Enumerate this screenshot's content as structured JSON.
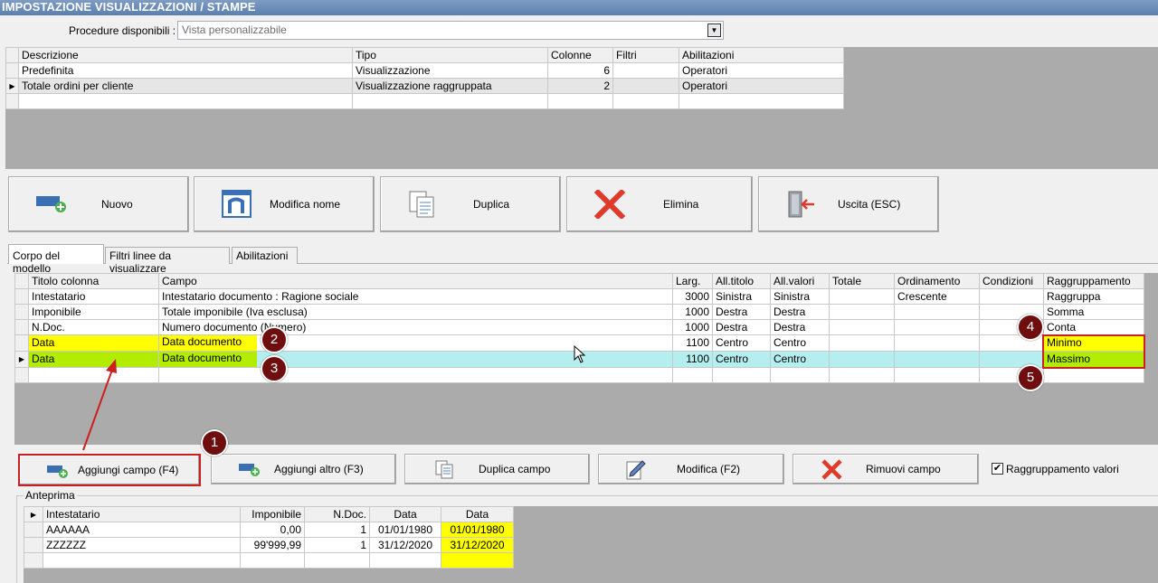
{
  "window": {
    "title": "IMPOSTAZIONE VISUALIZZAZIONI / STAMPE"
  },
  "procedure": {
    "label": "Procedure disponibili :",
    "value": "Vista personalizzabile"
  },
  "views_grid": {
    "headers": [
      "Descrizione",
      "Tipo",
      "Colonne",
      "Filtri",
      "Abilitazioni"
    ],
    "rows": [
      [
        "Predefinita",
        "Visualizzazione",
        "6",
        "",
        "Operatori"
      ],
      [
        "Totale ordini per cliente",
        "Visualizzazione raggruppata",
        "2",
        "",
        "Operatori"
      ]
    ]
  },
  "toolbar": {
    "nuovo": "Nuovo",
    "modifica_nome": "Modifica nome",
    "duplica": "Duplica",
    "elimina": "Elimina",
    "uscita": "Uscita (ESC)"
  },
  "tabs": [
    "Corpo del modello",
    "Filtri linee da visualizzare",
    "Abilitazioni"
  ],
  "fields_grid": {
    "headers": [
      "Titolo colonna",
      "Campo",
      "Larg.",
      "All.titolo",
      "All.valori",
      "Totale",
      "Ordinamento",
      "Condizioni",
      "Raggruppamento"
    ],
    "rows": [
      [
        "Intestatario",
        "Intestatario documento : Ragione sociale",
        "3000",
        "Sinistra",
        "Sinistra",
        "",
        "Crescente",
        "",
        "Raggruppa"
      ],
      [
        "Imponibile",
        "Totale imponibile (Iva esclusa)",
        "1000",
        "Destra",
        "Destra",
        "",
        "",
        "",
        "Somma"
      ],
      [
        "N.Doc.",
        "Numero documento (Numero)",
        "1000",
        "Destra",
        "Destra",
        "",
        "",
        "",
        "Conta"
      ],
      [
        "Data",
        "Data documento",
        "1100",
        "Centro",
        "Centro",
        "",
        "",
        "",
        "Minimo"
      ],
      [
        "Data",
        "Data documento",
        "1100",
        "Centro",
        "Centro",
        "",
        "",
        "",
        "Massimo"
      ]
    ]
  },
  "field_buttons": {
    "aggiungi_campo": "Aggiungi campo (F4)",
    "aggiungi_altro": "Aggiungi altro (F3)",
    "duplica_campo": "Duplica campo",
    "modifica": "Modifica (F2)",
    "rimuovi_campo": "Rimuovi campo"
  },
  "raggruppamento_valori": {
    "label": "Raggruppamento valori",
    "checked": true
  },
  "anteprima": {
    "label": "Anteprima",
    "headers": [
      "Intestatario",
      "Imponibile",
      "N.Doc.",
      "Data",
      "Data"
    ],
    "rows": [
      [
        "AAAAAA",
        "0,00",
        "1",
        "01/01/1980",
        "01/01/1980"
      ],
      [
        "ZZZZZZ",
        "99'999,99",
        "1",
        "31/12/2020",
        "31/12/2020"
      ]
    ]
  },
  "callouts": [
    "1",
    "2",
    "3",
    "4",
    "5"
  ],
  "colors": {
    "yellow": "#ffff00",
    "green": "#b2ec00",
    "cyan": "#b5eeee",
    "callout": "#6e0e0e",
    "highlight_border": "#cc1f1f"
  }
}
